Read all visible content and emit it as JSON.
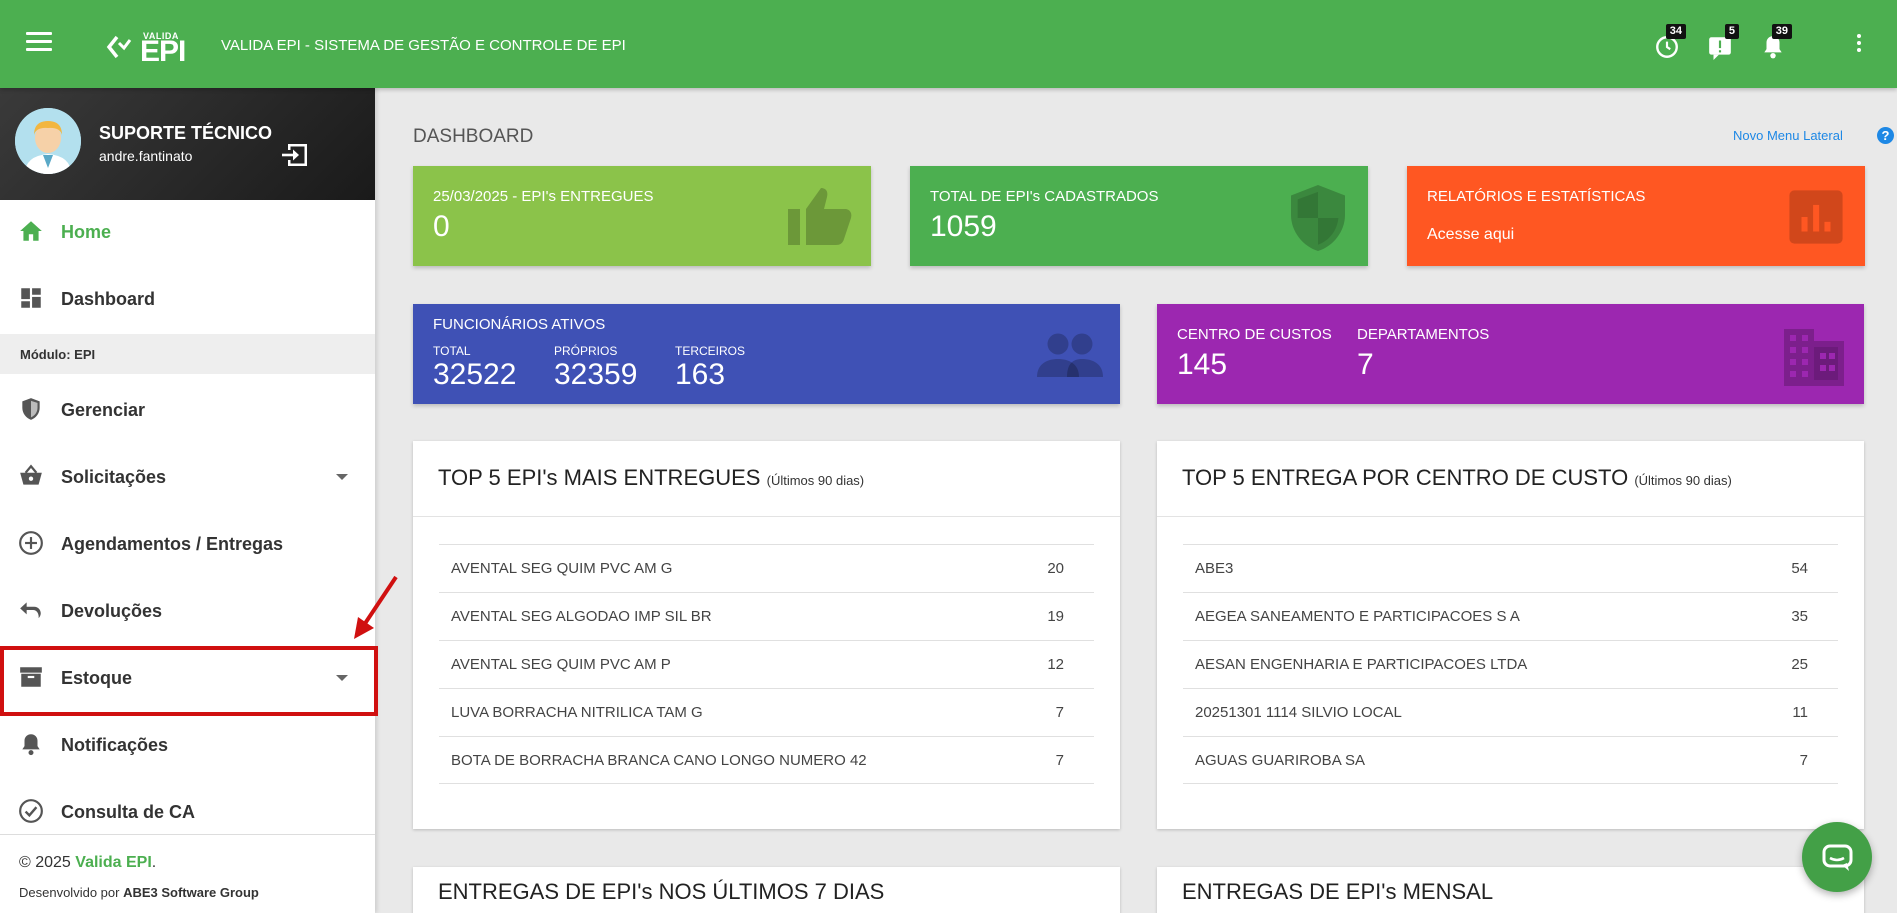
{
  "header": {
    "logo_small": "VALIDA",
    "logo_big": "EPI",
    "title": "VALIDA EPI - SISTEMA DE GESTÃO E CONTROLE DE EPI",
    "badges": {
      "history": "34",
      "alerts": "5",
      "notifications": "39"
    }
  },
  "user": {
    "name": "SUPORTE TÉCNICO",
    "login": "andre.fantinato"
  },
  "sidebar": {
    "home": "Home",
    "dashboard": "Dashboard",
    "module_prefix": "Módulo:",
    "module_name": "EPI",
    "items": [
      "Gerenciar",
      "Solicitações",
      "Agendamentos / Entregas",
      "Devoluções",
      "Estoque",
      "Notificações",
      "Consulta de CA"
    ],
    "footer_copy": "© 2025 ",
    "footer_brand": "Valida EPI",
    "footer_dot": ".",
    "footer_dev_prefix": "Desenvolvido por ",
    "footer_dev": "ABE3 Software Group"
  },
  "page": {
    "title": "DASHBOARD",
    "new_menu": "Novo Menu Lateral",
    "help": "?"
  },
  "cards": {
    "delivered": {
      "title": "25/03/2025 - EPI's ENTREGUES",
      "value": "0",
      "color": "#8bc34a"
    },
    "registered": {
      "title": "TOTAL DE EPI's CADASTRADOS",
      "value": "1059",
      "color": "#4caf50"
    },
    "reports": {
      "title": "RELATÓRIOS E ESTATÍSTICAS",
      "link": "Acesse aqui",
      "color": "#ff5722"
    },
    "employees": {
      "title": "FUNCIONÁRIOS ATIVOS",
      "total_label": "TOTAL",
      "total": "32522",
      "own_label": "PRÓPRIOS",
      "own": "32359",
      "third_label": "TERCEIROS",
      "third": "163",
      "color": "#3f51b5"
    },
    "centers": {
      "cc_label": "CENTRO DE CUSTOS",
      "cc": "145",
      "dept_label": "DEPARTAMENTOS",
      "dept": "7",
      "color": "#9c27b0"
    }
  },
  "top_epi": {
    "title": "TOP 5 EPI's MAIS ENTREGUES",
    "period": "(Últimos 90 dias)",
    "rows": [
      {
        "name": "AVENTAL SEG QUIM PVC AM G",
        "value": "20"
      },
      {
        "name": "AVENTAL SEG ALGODAO IMP SIL BR",
        "value": "19"
      },
      {
        "name": "AVENTAL SEG QUIM PVC AM P",
        "value": "12"
      },
      {
        "name": "LUVA BORRACHA NITRILICA TAM G",
        "value": "7"
      },
      {
        "name": "BOTA DE BORRACHA BRANCA CANO LONGO NUMERO 42",
        "value": "7"
      }
    ]
  },
  "top_cc": {
    "title": "TOP 5 ENTREGA POR CENTRO DE CUSTO",
    "period": "(Últimos 90 dias)",
    "rows": [
      {
        "name": "ABE3",
        "value": "54"
      },
      {
        "name": "AEGEA SANEAMENTO E PARTICIPACOES S A",
        "value": "35"
      },
      {
        "name": "AESAN ENGENHARIA E PARTICIPACOES LTDA",
        "value": "25"
      },
      {
        "name": "20251301 1114 SILVIO LOCAL",
        "value": "11"
      },
      {
        "name": "AGUAS GUARIROBA SA",
        "value": "7"
      }
    ]
  },
  "bottom": {
    "left_title": "ENTREGAS DE EPI's NOS ÚLTIMOS 7 DIAS",
    "right_title": "ENTREGAS DE EPI's MENSAL"
  },
  "icons": [
    "menu-icon",
    "history-icon",
    "alert-icon",
    "bell-icon",
    "more-vert-icon",
    "logout-icon",
    "home-icon",
    "dashboard-icon",
    "shield-icon",
    "basket-icon",
    "add-circle-icon",
    "undo-icon",
    "archive-icon",
    "check-circle-icon",
    "thumb-up-icon",
    "bar-chart-icon",
    "people-icon",
    "building-icon",
    "chat-icon"
  ]
}
